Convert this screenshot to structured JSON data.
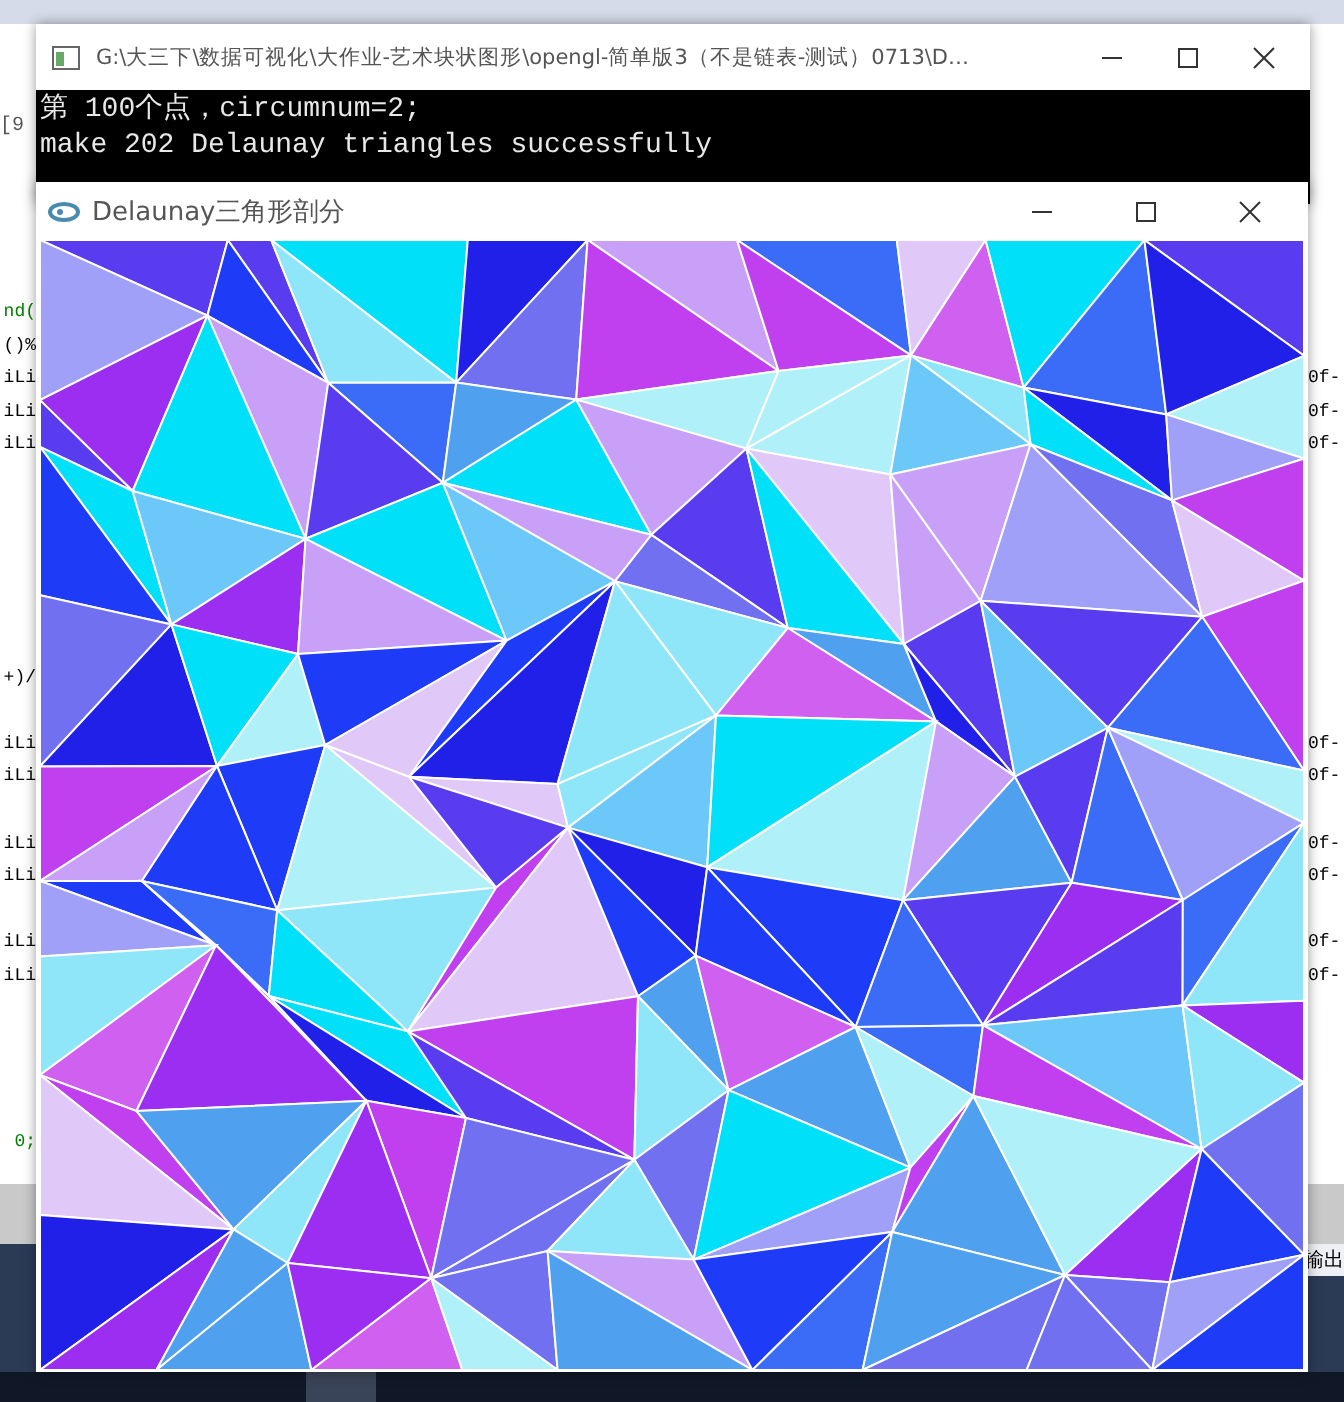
{
  "ide": {
    "line_ref": "[9",
    "left_fragments": [
      {
        "text": "nd(",
        "kind": "comment"
      },
      {
        "text": "()%",
        "kind": "code"
      },
      {
        "text": "iLi",
        "kind": "code"
      },
      {
        "text": "iLi",
        "kind": "code"
      },
      {
        "text": "iLi",
        "kind": "code"
      },
      {
        "text": "+)/",
        "kind": "code"
      },
      {
        "text": "iLi",
        "kind": "code"
      },
      {
        "text": "iLi",
        "kind": "code"
      },
      {
        "text": "iLi",
        "kind": "code"
      },
      {
        "text": "iLi",
        "kind": "code"
      },
      {
        "text": "iLi",
        "kind": "code"
      },
      {
        "text": "iLi",
        "kind": "code"
      },
      {
        "text": "0;",
        "kind": "comment"
      }
    ],
    "right_fragments": [
      {
        "text": "0f-",
        "kind": "code"
      },
      {
        "text": "0f-",
        "kind": "code"
      },
      {
        "text": "0f-",
        "kind": "code"
      },
      {
        "text": "0f-",
        "kind": "code"
      },
      {
        "text": "0f-",
        "kind": "code"
      },
      {
        "text": "0f-",
        "kind": "code"
      },
      {
        "text": "0f-",
        "kind": "code"
      },
      {
        "text": "0f-",
        "kind": "code"
      },
      {
        "text": "0f-",
        "kind": "code"
      }
    ],
    "output_tab": "输出"
  },
  "console": {
    "title": "G:\\大三下\\数据可视化\\大作业-艺术块状图形\\opengl-简单版3（不是链表-测试）0713\\D…",
    "lines": [
      "第 100个点，circumnum=2;",
      "make 202 Delaunay triangles successfully"
    ]
  },
  "gl_window": {
    "title": "Delaunay三角形剖分"
  }
}
